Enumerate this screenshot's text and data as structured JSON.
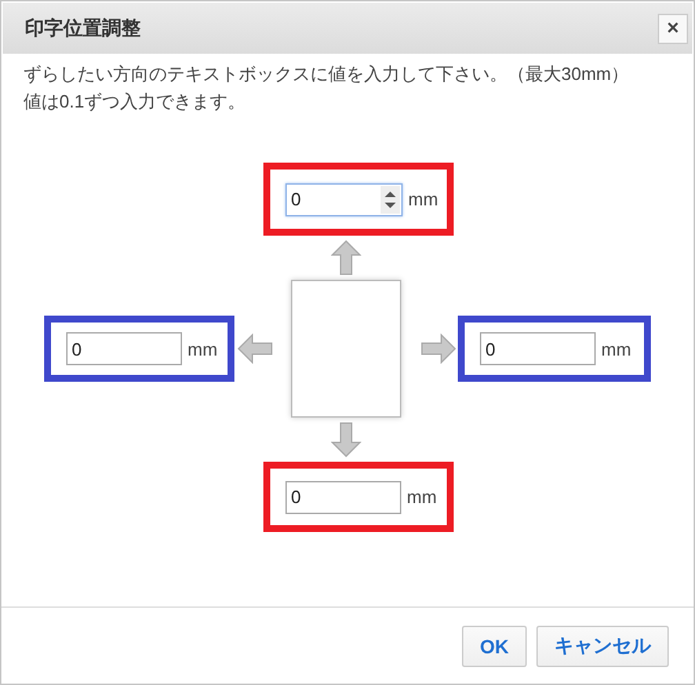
{
  "dialog": {
    "title": "印字位置調整",
    "close": "×"
  },
  "instructions": [
    "ずらしたい方向のテキストボックスに値を入力して下さい。（最大30mm）",
    "値は0.1ずつ入力できます。"
  ],
  "offsets": {
    "top": {
      "value": "0",
      "unit": "mm",
      "color": "#ed1c24",
      "focused": true
    },
    "left": {
      "value": "0",
      "unit": "mm",
      "color": "#3f48cc",
      "focused": false
    },
    "right": {
      "value": "0",
      "unit": "mm",
      "color": "#3f48cc",
      "focused": false
    },
    "bottom": {
      "value": "0",
      "unit": "mm",
      "color": "#ed1c24",
      "focused": false
    }
  },
  "buttons": [
    "OK",
    "キャンセル"
  ]
}
